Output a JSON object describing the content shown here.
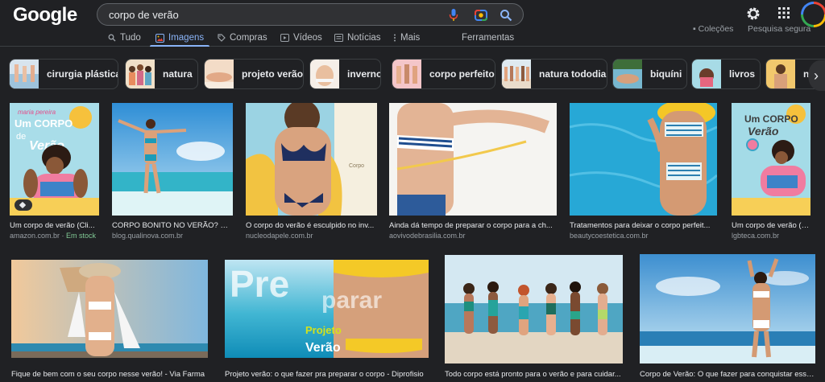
{
  "header": {
    "logo": "Google",
    "search_value": "corpo de verão",
    "clear_label": "×"
  },
  "tabs": [
    {
      "label": "Tudo",
      "icon": "search-icon",
      "active": false
    },
    {
      "label": "Imagens",
      "icon": "image-icon",
      "active": true
    },
    {
      "label": "Compras",
      "icon": "tag-icon",
      "active": false
    },
    {
      "label": "Vídeos",
      "icon": "play-icon",
      "active": false
    },
    {
      "label": "Notícias",
      "icon": "news-icon",
      "active": false
    },
    {
      "label": "Mais",
      "icon": "more-vert-icon",
      "active": false
    }
  ],
  "tools_label": "Ferramentas",
  "top_right": {
    "collections": "Coleções",
    "safe_search": "Pesquisa segura"
  },
  "chips": [
    {
      "label": "cirurgia plástica"
    },
    {
      "label": "natura"
    },
    {
      "label": "projeto verão"
    },
    {
      "label": "inverno"
    },
    {
      "label": "corpo perfeito"
    },
    {
      "label": "natura tododia"
    },
    {
      "label": "biquíni"
    },
    {
      "label": "livros"
    },
    {
      "label": "no"
    }
  ],
  "chip_next_label": "›",
  "results_row1": [
    {
      "title": "Um corpo de verão (Cli...",
      "source": "amazon.com.br",
      "extra": "Em stock",
      "sep": " · "
    },
    {
      "title": "CORPO BONITO NO VERÃO? CO...",
      "source": "blog.qualinova.com.br"
    },
    {
      "title": "O corpo do verão é esculpido no inv...",
      "source": "nucleodapele.com.br"
    },
    {
      "title": "Ainda dá tempo de preparar o corpo para a ch...",
      "source": "aovivodebrasilia.com.br"
    },
    {
      "title": "Tratamentos para deixar o corpo perfeit...",
      "source": "beautycoestetica.com.br"
    },
    {
      "title": "Um corpo de verão (Cli...",
      "source": "lgbteca.com.br"
    }
  ],
  "results_row2": [
    {
      "title": "Fique de bem com o seu corpo nesse verão! - Via Farma"
    },
    {
      "title": "Projeto verão: o que fazer pra preparar o corpo - Diprofisio"
    },
    {
      "title": "Todo corpo está pronto para o verão e para cuidar..."
    },
    {
      "title": "Corpo de Verão: O que fazer para conquistar esse ..."
    }
  ],
  "book_text": {
    "line1": "Um CORPO",
    "line2": "de",
    "line3": "Verão",
    "author": "maria pereira"
  },
  "prep_text": {
    "big1": "Pre",
    "big2": "parar",
    "proj1": "Projeto",
    "proj2": "Verão"
  },
  "colors": {
    "bg": "#202124",
    "accent": "#8ab4f8",
    "text": "#e8eaed",
    "muted": "#9aa0a6",
    "stock": "#81c995"
  }
}
